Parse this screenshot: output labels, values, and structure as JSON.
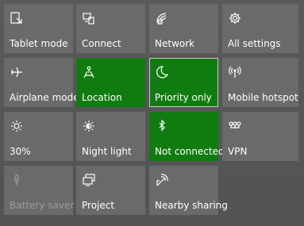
{
  "action_center": {
    "tiles": [
      {
        "label": "Tablet mode",
        "icon": "tablet-mode-icon",
        "state": "off"
      },
      {
        "label": "Connect",
        "icon": "connect-icon",
        "state": "off"
      },
      {
        "label": "Network",
        "icon": "network-icon",
        "state": "off"
      },
      {
        "label": "All settings",
        "icon": "gear-icon",
        "state": "off"
      },
      {
        "label": "Airplane mode",
        "icon": "airplane-icon",
        "state": "off"
      },
      {
        "label": "Location",
        "icon": "location-icon",
        "state": "on"
      },
      {
        "label": "Priority only",
        "icon": "moon-icon",
        "state": "on"
      },
      {
        "label": "Mobile hotspot",
        "icon": "mobile-hotspot-icon",
        "state": "off"
      },
      {
        "label": "30%",
        "icon": "brightness-icon",
        "state": "off"
      },
      {
        "label": "Night light",
        "icon": "night-light-icon",
        "state": "off"
      },
      {
        "label": "Not connected",
        "icon": "bluetooth-icon",
        "state": "on"
      },
      {
        "label": "VPN",
        "icon": "vpn-icon",
        "state": "off"
      },
      {
        "label": "Battery saver",
        "icon": "battery-saver-icon",
        "state": "disabled"
      },
      {
        "label": "Project",
        "icon": "project-icon",
        "state": "off"
      },
      {
        "label": "Nearby sharing",
        "icon": "nearby-sharing-icon",
        "state": "off"
      }
    ],
    "colors": {
      "tile_off": "#6a6a6a",
      "tile_on": "#107c10",
      "text": "#ffffff",
      "text_disabled": "#9a9a9a",
      "background": "#555555"
    }
  }
}
